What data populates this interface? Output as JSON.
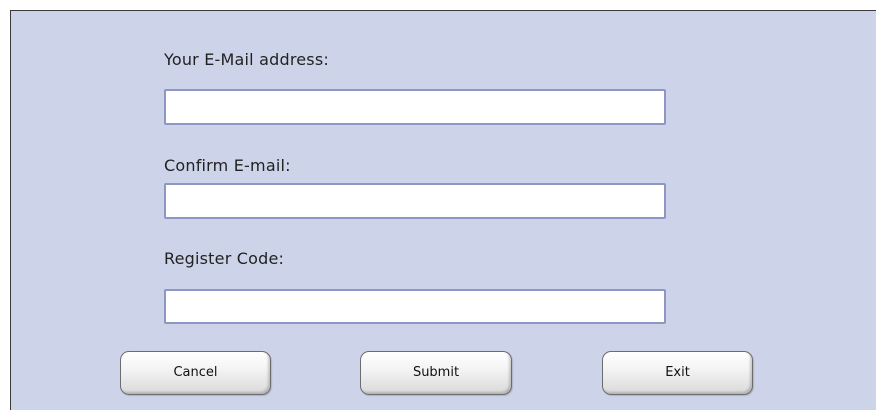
{
  "form": {
    "email_label": "Your E-Mail address:",
    "email_value": "",
    "confirm_label": "Confirm E-mail:",
    "confirm_value": "",
    "code_label": "Register Code:",
    "code_value": ""
  },
  "buttons": {
    "cancel": "Cancel",
    "submit": "Submit",
    "exit": "Exit"
  },
  "colors": {
    "panel_background": "#cdd4ea",
    "field_border": "#8e97c4"
  }
}
